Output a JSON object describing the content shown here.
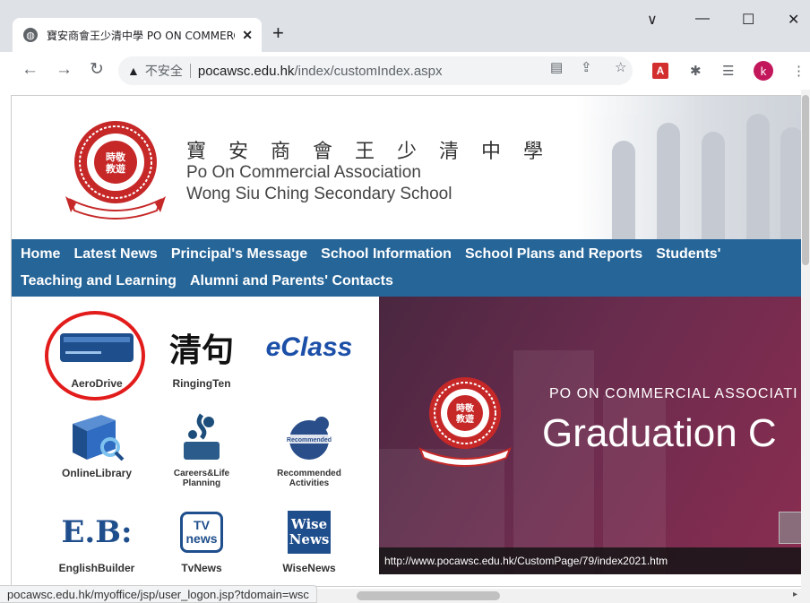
{
  "browser": {
    "tab_title": "寶安商會王少清中學 PO ON COMMERCIAL",
    "tab_favicon": "globe-icon",
    "new_tab": "+",
    "window_controls": {
      "chevron": "∨",
      "minimize": "—",
      "maximize": "☐",
      "close": "✕"
    },
    "security_label": "不安全",
    "url_host": "pocawsc.edu.hk",
    "url_path": "/index/customIndex.aspx",
    "profile_initial": "k"
  },
  "header": {
    "name_cn": "寶 安 商 會 王 少 清 中 學",
    "name_en_line1": "Po On Commercial Association",
    "name_en_line2": "Wong Siu Ching Secondary School",
    "logo_badge": "時敬\n教遊"
  },
  "nav": {
    "row1": [
      "Home",
      "Latest News",
      "Principal's Message",
      "School Information",
      "School Plans and Reports",
      "Students'"
    ],
    "row2": [
      "Teaching and Learning",
      "Alumni and Parents' Contacts"
    ]
  },
  "apps": [
    {
      "label": "AeroDrive",
      "icon": "aerodrive-icon"
    },
    {
      "label": "RingingTen",
      "icon": "ringingten-icon",
      "glyph": "清句"
    },
    {
      "label": "",
      "icon": "eclass-icon",
      "glyph": "eClass"
    },
    {
      "label": "OnlineLibrary",
      "icon": "online-library-icon"
    },
    {
      "label": "Careers&Life\nPlanning",
      "icon": "careers-icon"
    },
    {
      "label": "Recommended\nActivities",
      "icon": "recommended-activities-icon"
    },
    {
      "label": "EnglishBuilder",
      "icon": "english-builder-icon",
      "glyph": "E.B:"
    },
    {
      "label": "TvNews",
      "icon": "tvnews-icon",
      "glyph": "TV news"
    },
    {
      "label": "WiseNews",
      "icon": "wisenews-icon",
      "glyph": "Wise News"
    }
  ],
  "banner": {
    "subtitle": "PO ON COMMERCIAL ASSOCIATI",
    "title": "Graduation C",
    "url": "http://www.pocawsc.edu.hk/CustomPage/79/index2021.htm"
  },
  "status_bar": "pocawsc.edu.hk/myoffice/jsp/user_logon.jsp?tdomain=wsc",
  "colors": {
    "nav_bg": "#266598",
    "highlight_circle": "#e21b1b",
    "banner_bg": "#6a2c4e"
  }
}
